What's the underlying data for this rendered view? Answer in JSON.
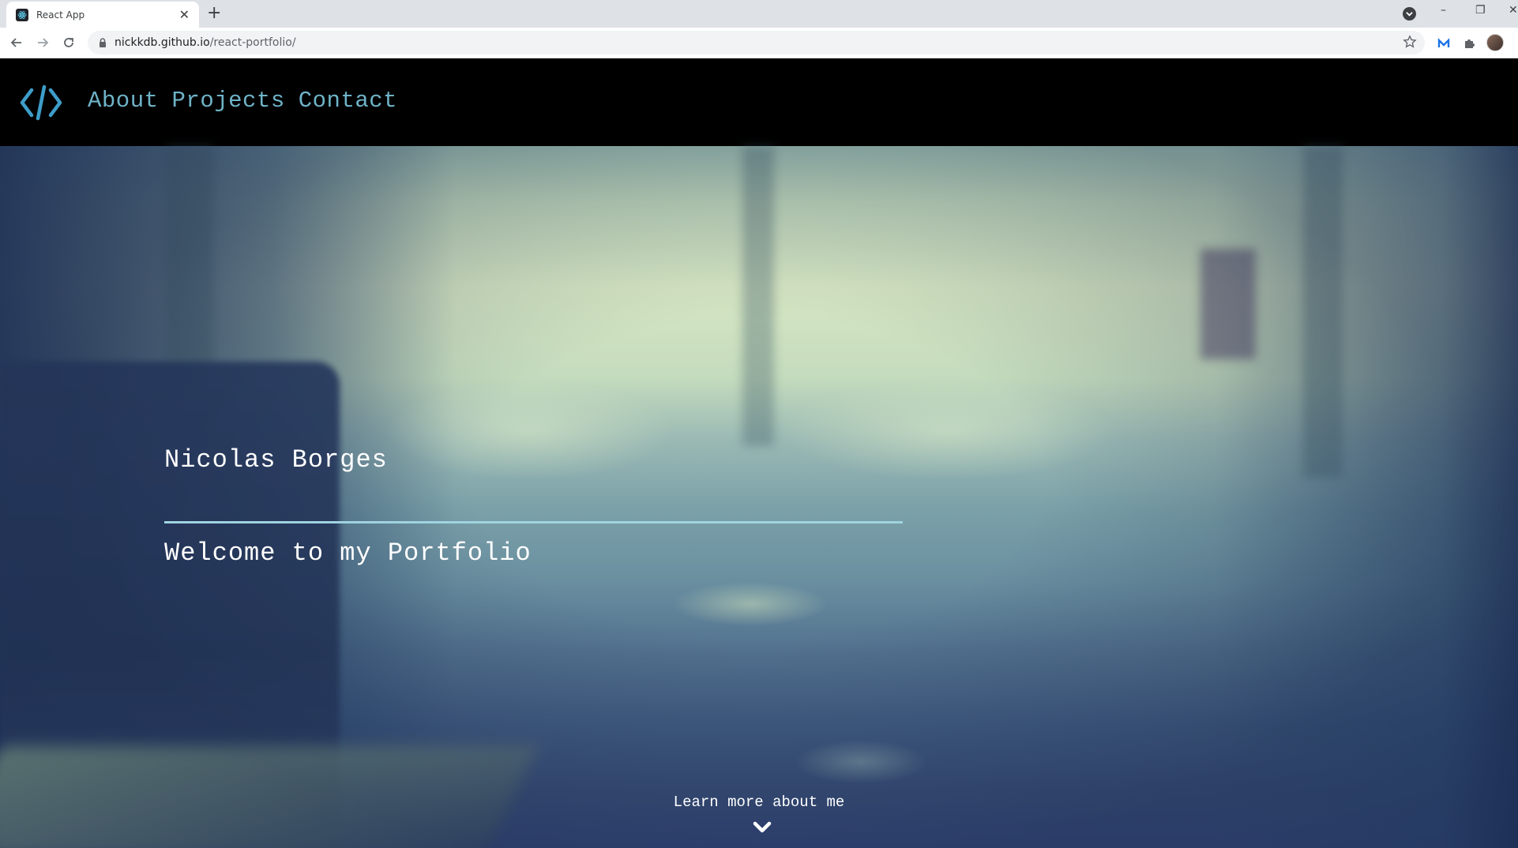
{
  "browser": {
    "tab_title": "React App",
    "tab_close": "✕",
    "new_tab": "+",
    "url_host": "nickkdb.github.io",
    "url_path": "/react-portfolio/",
    "window_controls": [
      "–",
      "❐",
      "✕"
    ]
  },
  "site": {
    "nav": {
      "logo_icon": "code-brackets-icon",
      "links": [
        "About",
        "Projects",
        "Contact"
      ]
    },
    "hero": {
      "title": "Nicolas Borges",
      "subtitle": "Welcome to my Portfolio",
      "learn_more": "Learn more about me",
      "chevron_icon": "chevron-down-icon"
    }
  },
  "colors": {
    "nav_bg": "#000000",
    "accent": "#6fb3c8",
    "rule": "#9fd3e0",
    "hero_text": "#ffffff"
  }
}
